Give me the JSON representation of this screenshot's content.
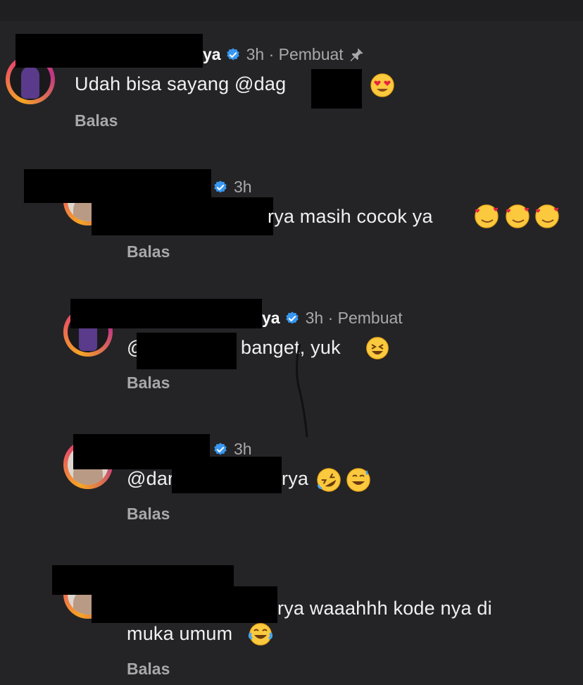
{
  "comments": [
    {
      "name_tail": "ya",
      "time": "3h",
      "creator_label": "· Pembuat",
      "pinned": true,
      "text_pre": "Udah bisa sayang @dag",
      "text_post": "",
      "reply_label": "Balas",
      "emoji": [
        "heart-eyes-emoji"
      ]
    },
    {
      "name_tail": "",
      "time": "3h",
      "text_pre": "",
      "text_post": "rya masih cocok ya",
      "reply_label": "Balas",
      "emoji": [
        "smiling-hearts-emoji",
        "smiling-hearts-emoji",
        "smiling-hearts-emoji"
      ]
    },
    {
      "name_tail": "ya",
      "time": "3h",
      "creator_label": "· Pembuat",
      "text_pre": "@",
      "text_post": "banget, yuk",
      "reply_label": "Balas",
      "emoji": [
        "grinning-squint-emoji"
      ]
    },
    {
      "name_tail": "",
      "time": "3h",
      "text_pre": "@dar",
      "text_post": "rya",
      "reply_label": "Balas",
      "emoji": [
        "rofl-emoji",
        "grinning-sweat-emoji"
      ]
    },
    {
      "name_tail": "",
      "time": "",
      "text_pre": "",
      "text_post": "rya waaahhh kode nya di",
      "text_line2": "muka umum",
      "reply_label": "Balas",
      "emoji": [
        "tears-of-joy-emoji"
      ]
    }
  ],
  "colors": {
    "background": "#242426",
    "verified": "#3897f0",
    "muted_text": "#a8a8aa",
    "ring_start": "#f6a524",
    "ring_end": "#c13584"
  },
  "icons": [
    "verified-badge-icon",
    "pin-icon"
  ]
}
